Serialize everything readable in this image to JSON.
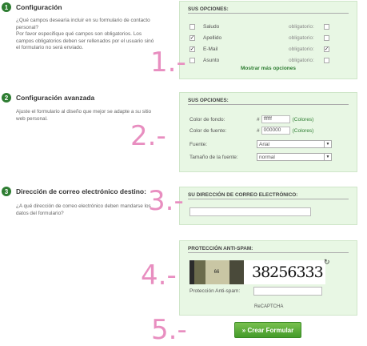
{
  "section1": {
    "number": "1",
    "title": "Configuración",
    "description_lines": [
      "¿Qué campos desearía incluir en su formulario de contacto",
      "personal?",
      "Por favor especifique qué campos son obligatorios. Los",
      "campos obligatorios deben ser rellenados por el usuario sinó",
      "el formulario no será enviado."
    ],
    "panel_title": "SUS OPCIONES:",
    "fields": [
      {
        "label": "Saludo",
        "included": false,
        "required_label": "obligatorio:",
        "required": false
      },
      {
        "label": "Apellido",
        "included": true,
        "required_label": "obligatorio:",
        "required": false
      },
      {
        "label": "E-Mail",
        "included": true,
        "required_label": "obligatorio:",
        "required": true
      },
      {
        "label": "Asunto",
        "included": false,
        "required_label": "obligatorio:",
        "required": false
      }
    ],
    "more_options": "Mostrar más opciones",
    "annotation": "1.-"
  },
  "section2": {
    "number": "2",
    "title": "Configuración avanzada",
    "description_lines": [
      "Ajuste el formulario al diseño que mejor se adapte a su sitio",
      "web personal."
    ],
    "panel_title": "SUS OPCIONES:",
    "bg_label": "Color de fondo:",
    "bg_hash": "#",
    "bg_value": "ffffff",
    "font_color_label": "Color de fuente:",
    "font_hash": "#",
    "font_value": "000000",
    "colors_link": "(Colores)",
    "font_label": "Fuente:",
    "font_selected": "Arial",
    "size_label": "Tamaño de la fuente:",
    "size_selected": "normal",
    "annotation": "2.-"
  },
  "section3": {
    "number": "3",
    "title": "Dirección de correo electrónico destino:",
    "description_lines": [
      "¿A qué dirección de correo electrónico deben mandarse los",
      "datos del formulario?"
    ],
    "panel_title": "SU DIRECCIÓN DE CORREO ELECTRÓNICO:",
    "email_value": "",
    "annotation": "3.-"
  },
  "section4": {
    "panel_title": "PROTECCIÓN ANTI-SPAM:",
    "captcha_photo_text": "66",
    "captcha_word": "38256333",
    "refresh_icon": "refresh-icon",
    "input_label": "Protección Anti-spam:",
    "input_value": "",
    "recaptcha_label": "ReCAPTCHA",
    "annotation": "4.-"
  },
  "submit": {
    "label": "» Crear Formular",
    "annotation": "5.-"
  },
  "colors": {
    "accent": "#2e7d32",
    "panel_bg": "#e8f7e4",
    "annotation_pink": "#e88ec0"
  }
}
